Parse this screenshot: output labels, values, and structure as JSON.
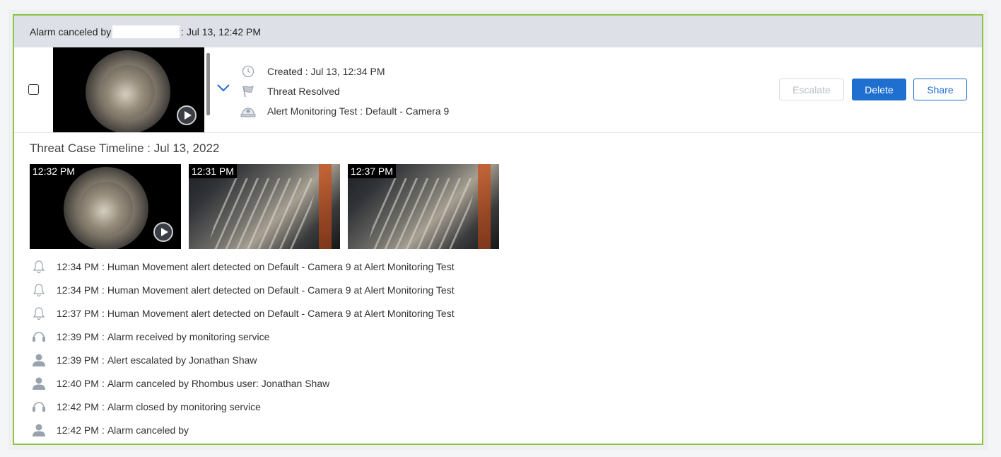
{
  "header": {
    "prefix": "Alarm canceled by",
    "suffix": ": Jul 13, 12:42 PM"
  },
  "alert": {
    "created": "Created : Jul 13, 12:34 PM",
    "status": "Threat Resolved",
    "camera": "Alert Monitoring Test : Default - Camera 9"
  },
  "actions": {
    "escalate": "Escalate",
    "delete": "Delete",
    "share": "Share"
  },
  "timeline": {
    "title": "Threat Case Timeline : Jul 13, 2022",
    "thumbnails": [
      {
        "time": "12:32 PM"
      },
      {
        "time": "12:31 PM"
      },
      {
        "time": "12:37 PM"
      }
    ],
    "events": [
      {
        "icon": "bell-icon",
        "time": "12:34 PM",
        "text": "Human Movement alert detected on Default - Camera 9 at Alert Monitoring Test"
      },
      {
        "icon": "bell-icon",
        "time": "12:34 PM",
        "text": "Human Movement alert detected on Default - Camera 9 at Alert Monitoring Test"
      },
      {
        "icon": "bell-icon",
        "time": "12:37 PM",
        "text": "Human Movement alert detected on Default - Camera 9 at Alert Monitoring Test"
      },
      {
        "icon": "headset-icon",
        "time": "12:39 PM",
        "text": "Alarm received by monitoring service"
      },
      {
        "icon": "user-icon",
        "time": "12:39 PM",
        "text": "Alert escalated by Jonathan Shaw"
      },
      {
        "icon": "user-icon",
        "time": "12:40 PM",
        "text": "Alarm canceled by Rhombus user: Jonathan Shaw"
      },
      {
        "icon": "headset-icon",
        "time": "12:42 PM",
        "text": "Alarm closed by monitoring service"
      },
      {
        "icon": "user-icon",
        "time": "12:42 PM",
        "text": "Alarm canceled by"
      }
    ]
  },
  "colors": {
    "accent": "#1f6fd1",
    "border": "#8cc63f",
    "header_bg": "#dde1e7",
    "icon_gray": "#9aa3ad"
  }
}
